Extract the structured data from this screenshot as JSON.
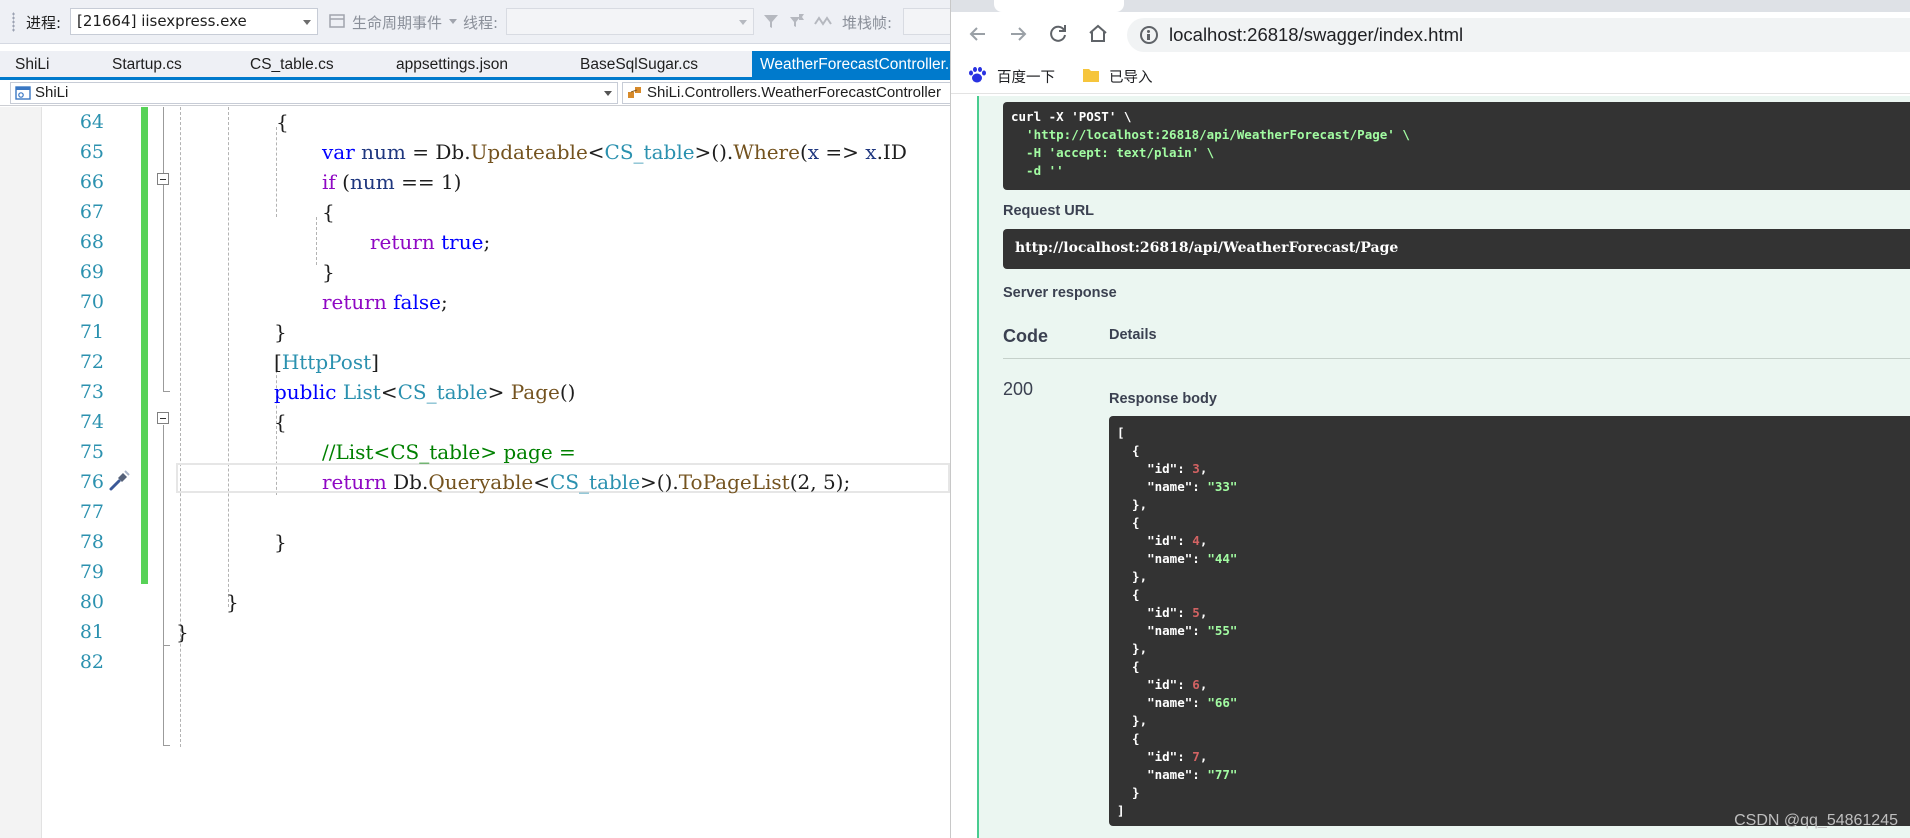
{
  "vs": {
    "toolbar": {
      "process_label": "进程:",
      "process_value": "[21664] iisexpress.exe",
      "lifecycle_label": "生命周期事件",
      "thread_label": "线程:",
      "thread_value": "",
      "stackframe_label": "堆栈帧:"
    },
    "tabs": [
      {
        "label": "ShiLi"
      },
      {
        "label": "Startup.cs"
      },
      {
        "label": "CS_table.cs"
      },
      {
        "label": "appsettings.json"
      },
      {
        "label": "BaseSqlSugar.cs"
      },
      {
        "label": "WeatherForecastController.cs",
        "active": true
      }
    ],
    "nav": {
      "project": "ShiLi",
      "member": "ShiLi.Controllers.WeatherForecastController"
    },
    "line_numbers": [
      "64",
      "65",
      "66",
      "67",
      "68",
      "69",
      "70",
      "71",
      "72",
      "73",
      "74",
      "75",
      "76",
      "77",
      "78",
      "79",
      "80",
      "81",
      "82"
    ],
    "colors": {
      "keyword": "#0000ff",
      "type": "#2b91af",
      "method": "#74531f",
      "comment": "#008000",
      "control": "#8f08c4",
      "line_number": "#2b91af",
      "change_bar": "#57d257",
      "active_tab": "#007acc"
    }
  },
  "browser": {
    "url": "localhost:26818/swagger/index.html",
    "bookmarks": [
      {
        "label": "百度一下",
        "icon": "baidu-paw-icon"
      },
      {
        "label": "已导入",
        "icon": "folder-icon"
      }
    ],
    "swagger": {
      "curl_lines": [
        "curl -X 'POST' \\",
        "  'http://localhost:26818/api/WeatherForecast/Page' \\",
        "  -H 'accept: text/plain' \\",
        "  -d ''"
      ],
      "request_url_label": "Request URL",
      "request_url": "http://localhost:26818/api/WeatherForecast/Page",
      "server_response_label": "Server response",
      "code_header": "Code",
      "details_header": "Details",
      "status_code": "200",
      "response_body_label": "Response body",
      "response_items": [
        {
          "id": 3,
          "name": "33"
        },
        {
          "id": 4,
          "name": "44"
        },
        {
          "id": 5,
          "name": "55"
        },
        {
          "id": 6,
          "name": "66"
        },
        {
          "id": 7,
          "name": "77"
        }
      ],
      "accent_color": "#49cc90"
    }
  },
  "watermark": "CSDN @qq_54861245"
}
